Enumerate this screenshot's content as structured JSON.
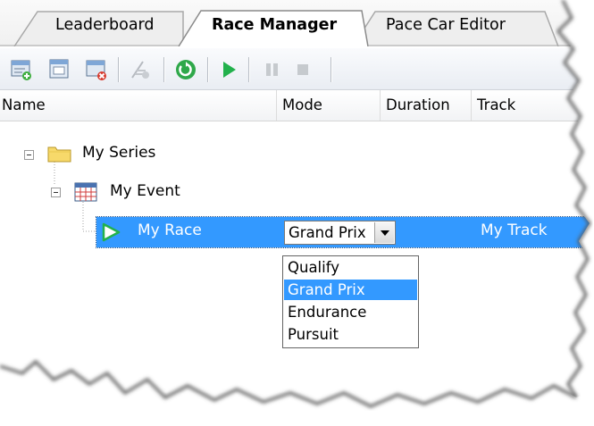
{
  "tabs": [
    {
      "label": "Leaderboard",
      "active": false
    },
    {
      "label": "Race Manager",
      "active": true
    },
    {
      "label": "Pace Car Editor",
      "active": false
    }
  ],
  "toolbar": {
    "buttons": [
      {
        "icon": "new-series-icon",
        "enabled": true
      },
      {
        "icon": "new-event-icon",
        "enabled": true
      },
      {
        "icon": "delete-icon",
        "enabled": true
      },
      {
        "icon": "flag-disabled-icon",
        "enabled": false
      },
      {
        "icon": "reset-icon",
        "enabled": true
      },
      {
        "icon": "play-icon",
        "enabled": true
      },
      {
        "icon": "pause-icon",
        "enabled": false
      },
      {
        "icon": "stop-icon",
        "enabled": false
      }
    ]
  },
  "columns": {
    "name": "Name",
    "mode": "Mode",
    "duration": "Duration",
    "track": "Track"
  },
  "tree": {
    "series": "My Series",
    "event": "My Event",
    "race": {
      "name": "My Race",
      "mode": "Grand Prix",
      "track": "My Track"
    }
  },
  "mode_dropdown": {
    "options": [
      "Qualify",
      "Grand Prix",
      "Endurance",
      "Pursuit"
    ],
    "selected": "Grand Prix"
  },
  "colors": {
    "selection": "#3399ff",
    "folder": "#f7d96a",
    "play": "#22b14c"
  }
}
